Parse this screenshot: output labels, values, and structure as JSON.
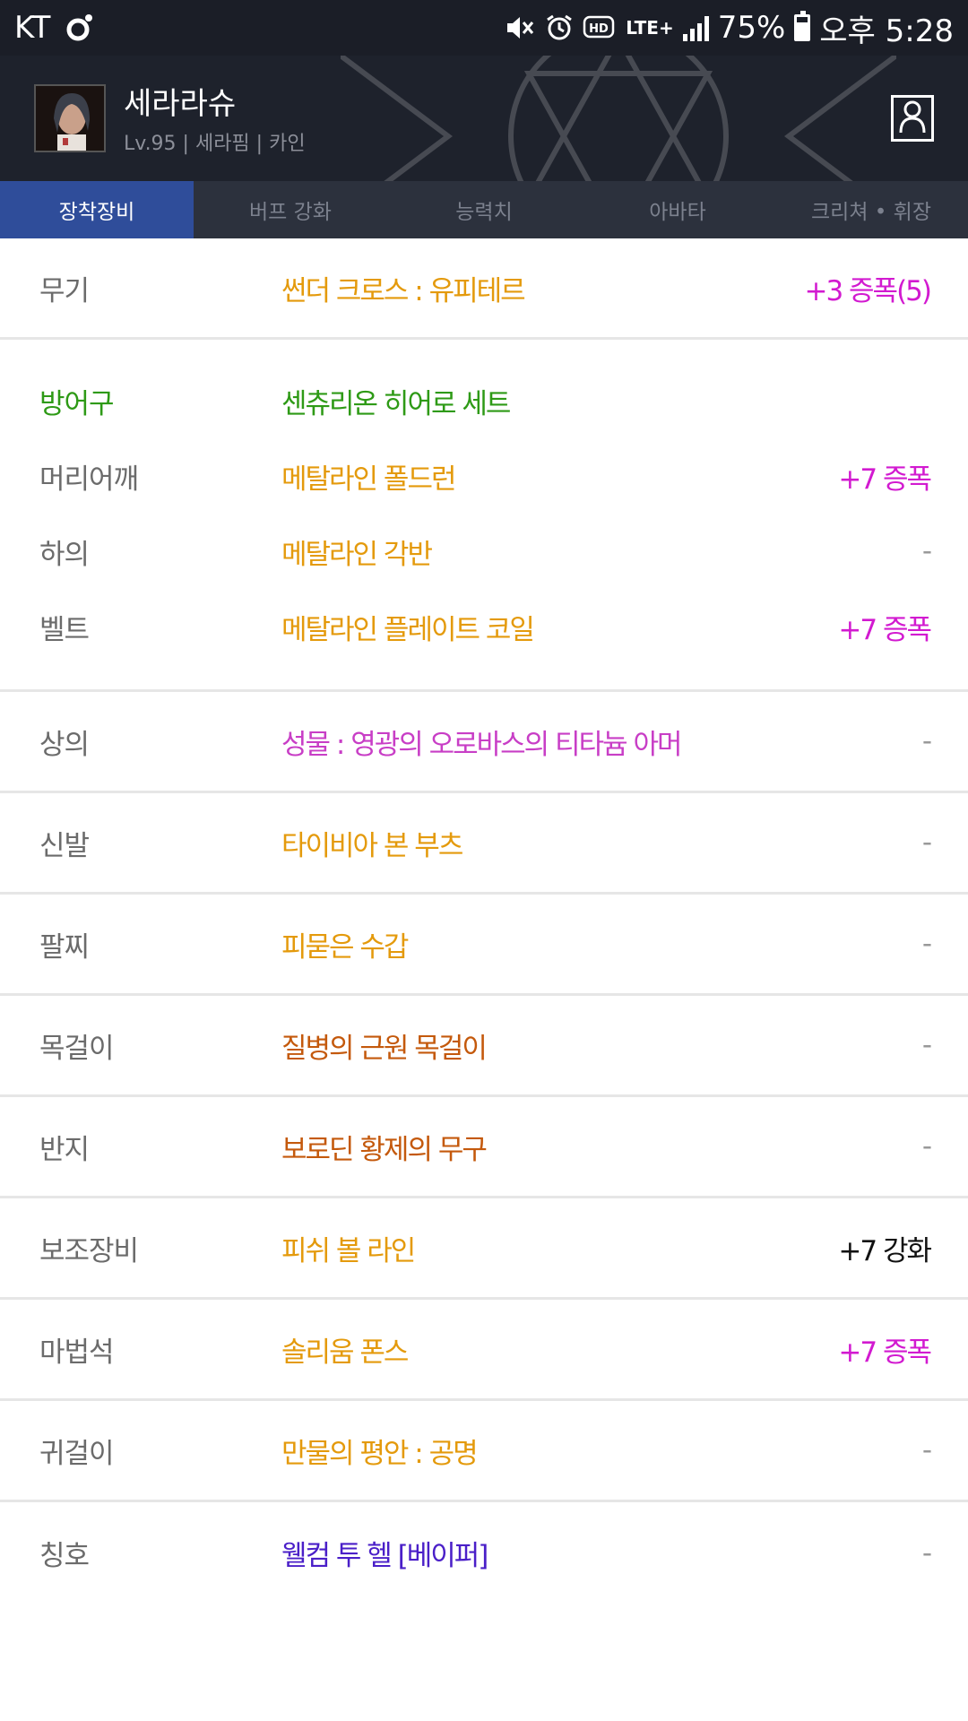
{
  "status_bar": {
    "carrier": "KT",
    "network": "LTE+",
    "battery_percent": "75%",
    "battery_level": 0.75,
    "time": "오후 5:28",
    "icons": [
      "circle-app-icon",
      "mute-icon",
      "alarm-icon",
      "hd-icon",
      "lte-icon",
      "signal-icon",
      "battery-icon"
    ]
  },
  "profile": {
    "name": "세라라슈",
    "subtitle": "Lv.95 | 세라핌 | 카인",
    "profile_button_icon": "person-icon"
  },
  "tabs": [
    {
      "label": "장착장비",
      "active": true
    },
    {
      "label": "버프 강화",
      "active": false
    },
    {
      "label": "능력치",
      "active": false
    },
    {
      "label": "아바타",
      "active": false
    },
    {
      "label": "크리쳐 • 휘장",
      "active": false
    }
  ],
  "colors": {
    "unique": "#e49a0c",
    "legendary": "#c4590c",
    "epic": "#c83ec6",
    "set": "#2e9a16",
    "rare": "#4a1fc8",
    "plus": "#d21ad0",
    "neutral": "#111111",
    "dash": "#999999"
  },
  "equipment": {
    "weapon": {
      "slot": "무기",
      "item": "썬더 크로스 : 유피테르",
      "enhance": "+3 증폭(5)"
    },
    "armor_group": {
      "slot": "방어구",
      "item": "센츄리온 히어로 세트",
      "rows": [
        {
          "slot": "머리어깨",
          "item": "메탈라인 폴드런",
          "enhance": "+7 증폭"
        },
        {
          "slot": "하의",
          "item": "메탈라인 각반",
          "enhance": "-"
        },
        {
          "slot": "벨트",
          "item": "메탈라인 플레이트 코일",
          "enhance": "+7 증폭"
        }
      ]
    },
    "rows": [
      {
        "slot": "상의",
        "item": "성물 : 영광의 오로바스의 티타늄 아머",
        "enhance": "-"
      },
      {
        "slot": "신발",
        "item": "타이비아 본 부츠",
        "enhance": "-"
      },
      {
        "slot": "팔찌",
        "item": "피묻은 수갑",
        "enhance": "-"
      },
      {
        "slot": "목걸이",
        "item": "질병의 근원 목걸이",
        "enhance": "-"
      },
      {
        "slot": "반지",
        "item": "보로딘 황제의 무구",
        "enhance": "-"
      },
      {
        "slot": "보조장비",
        "item": "피쉬 볼 라인",
        "enhance": "+7 강화"
      },
      {
        "slot": "마법석",
        "item": "솔리움 폰스",
        "enhance": "+7 증폭"
      },
      {
        "slot": "귀걸이",
        "item": "만물의 평안 : 공명",
        "enhance": "-"
      },
      {
        "slot": "칭호",
        "item": "웰컴 투 헬 [베이퍼]",
        "enhance": "-"
      }
    ]
  }
}
